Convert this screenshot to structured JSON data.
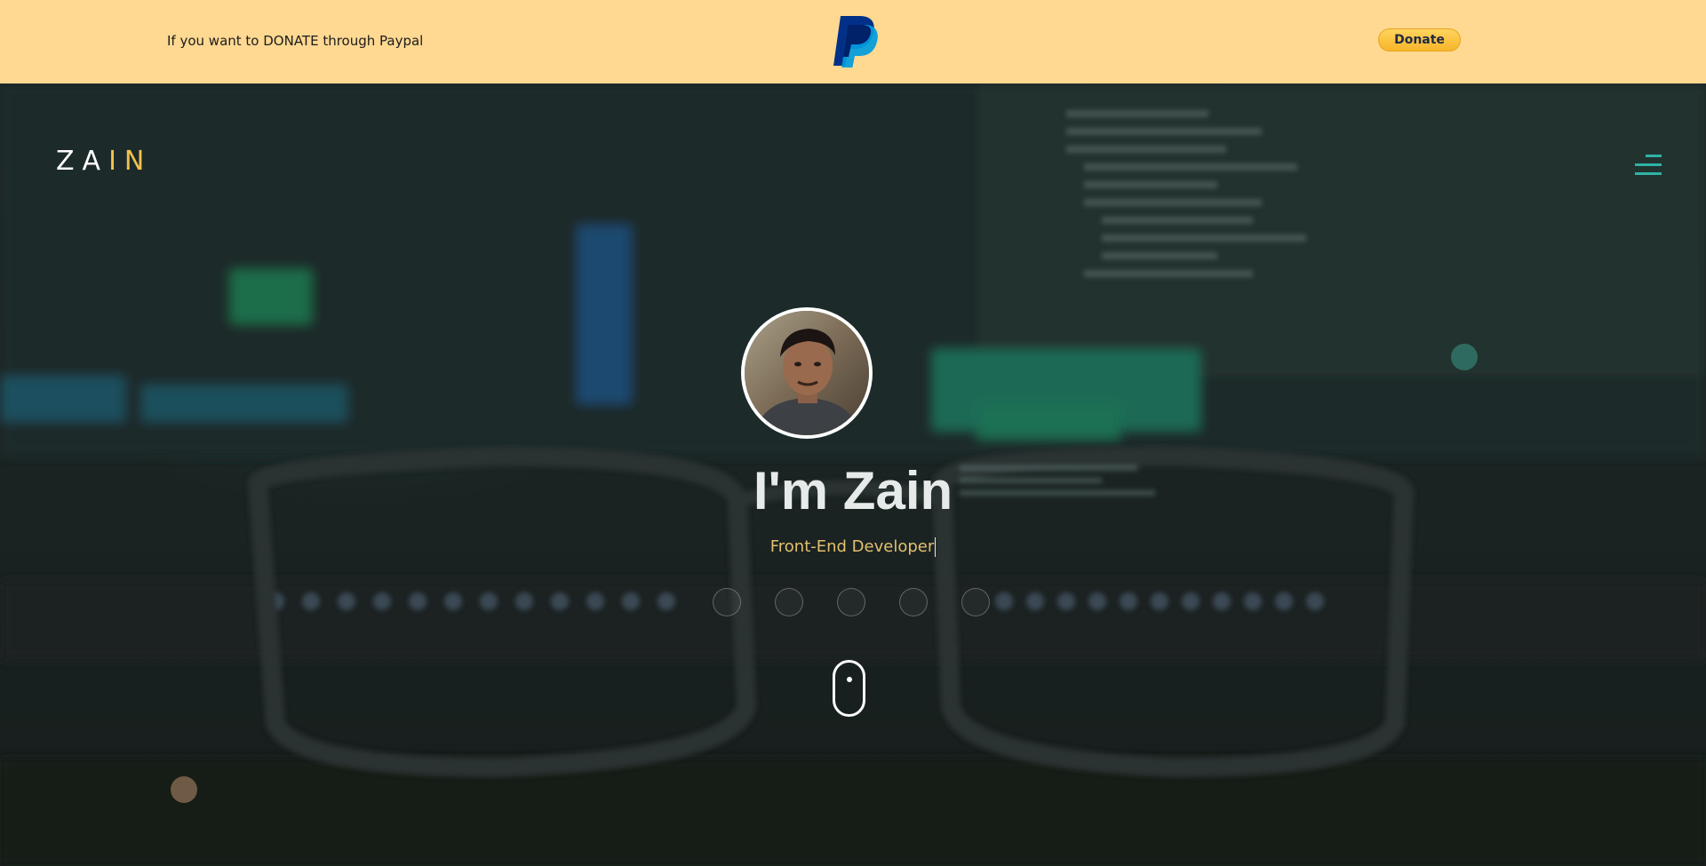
{
  "banner": {
    "text": "If you want to DONATE through Paypal",
    "paypal_icon": "paypal-logo-icon",
    "donate_label": "Donate",
    "background": "#ffd992"
  },
  "brand": {
    "logo_prefix": "ZA",
    "logo_accent": "IN",
    "accent_color": "#f2c14e"
  },
  "nav": {
    "menu_icon": "hamburger-menu-icon",
    "menu_color": "#2fb3a6"
  },
  "hero": {
    "avatar_icon": "profile-photo",
    "title": "I'm Zain",
    "subtitle": "Front-End Developer",
    "subtitle_color": "#e2c06d",
    "social_links": [
      {
        "icon": "social-icon-1"
      },
      {
        "icon": "social-icon-2"
      },
      {
        "icon": "social-icon-3"
      },
      {
        "icon": "social-icon-4"
      },
      {
        "icon": "social-icon-5"
      }
    ],
    "scroll_indicator_icon": "mouse-scroll-icon"
  }
}
